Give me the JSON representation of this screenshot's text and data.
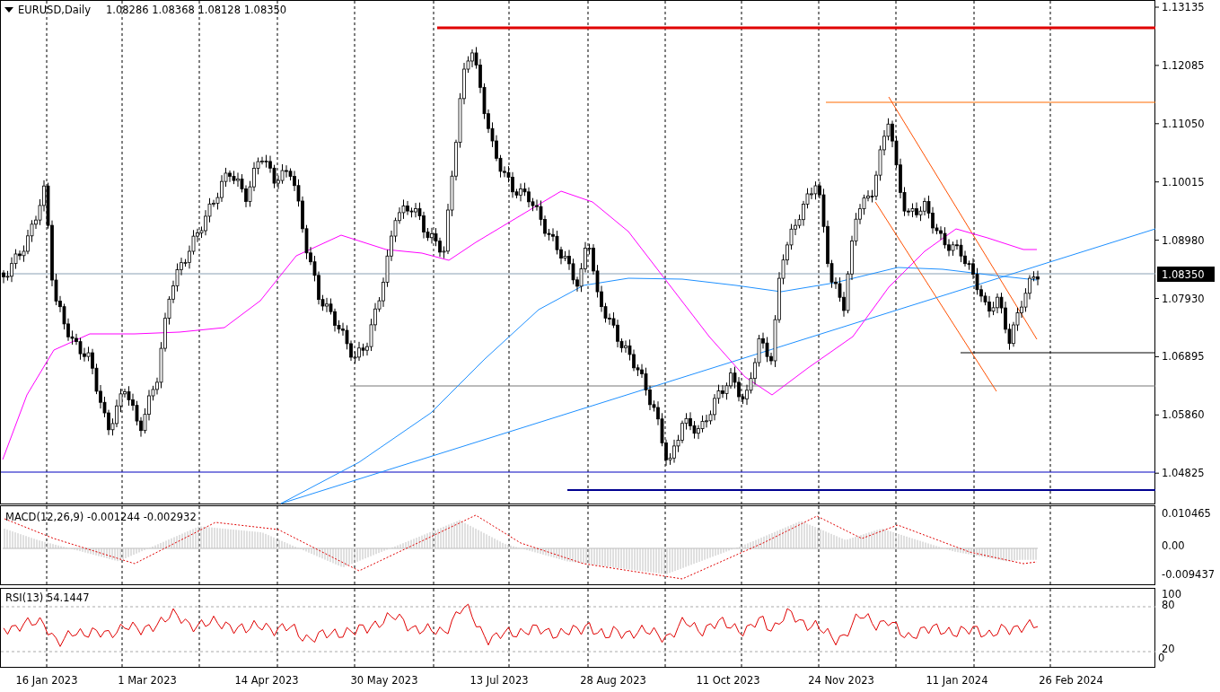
{
  "chart_header": {
    "symbol": "EURUSD,Daily",
    "ohlc": "1.08286 1.08368 1.08128 1.08350"
  },
  "price_axis": [
    "1.13135",
    "1.12085",
    "1.11050",
    "1.10015",
    "1.08980",
    "1.07930",
    "1.06895",
    "1.05860",
    "1.04825"
  ],
  "current_price": "1.08350",
  "macd": {
    "label": "MACD(12,26,9) -0.001244 -0.002932",
    "axis": [
      "0.010465",
      "0.00",
      "-0.009437"
    ]
  },
  "rsi": {
    "label": "RSI(13) 54.1447",
    "axis": [
      "100",
      "80",
      "20",
      "0"
    ]
  },
  "date_axis": [
    "16 Jan 2023",
    "1 Mar 2023",
    "14 Apr 2023",
    "30 May 2023",
    "13 Jul 2023",
    "28 Aug 2023",
    "11 Oct 2023",
    "24 Nov 2023",
    "11 Jan 2024",
    "26 Feb 2024"
  ]
}
